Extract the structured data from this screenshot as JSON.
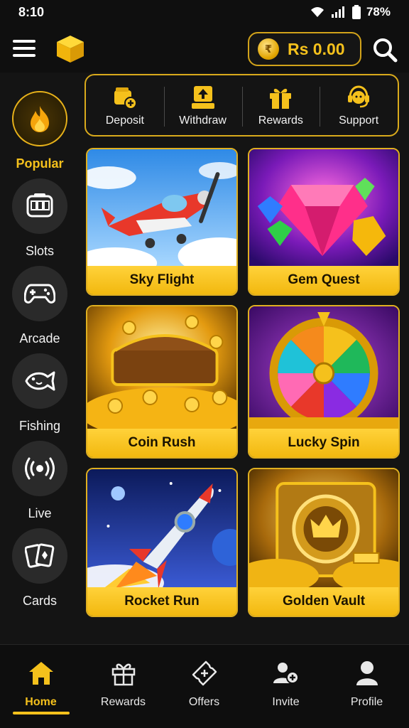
{
  "status_bar": {
    "time": "8:10",
    "battery": "78%"
  },
  "header": {
    "balance": "Rs 0.00",
    "currency_symbol": "₹"
  },
  "sidebar": {
    "items": [
      {
        "label": "Popular",
        "icon": "flame-icon",
        "active": true
      },
      {
        "label": "Slots",
        "icon": "slot-machine-icon",
        "active": false
      },
      {
        "label": "Arcade",
        "icon": "gamepad-icon",
        "active": false
      },
      {
        "label": "Fishing",
        "icon": "fish-icon",
        "active": false
      },
      {
        "label": "Live",
        "icon": "broadcast-icon",
        "active": false
      },
      {
        "label": "Cards",
        "icon": "playing-cards-icon",
        "active": false
      }
    ]
  },
  "quick_actions": [
    {
      "label": "Deposit",
      "icon": "wallet-plus-icon"
    },
    {
      "label": "Withdraw",
      "icon": "withdraw-upload-icon"
    },
    {
      "label": "Rewards",
      "icon": "gift-icon"
    },
    {
      "label": "Support",
      "icon": "headset-icon"
    }
  ],
  "games": [
    {
      "title": "Sky Flight",
      "art": "airplane"
    },
    {
      "title": "Gem Quest",
      "art": "gems"
    },
    {
      "title": "Coin Rush",
      "art": "treasure-chest"
    },
    {
      "title": "Lucky Spin",
      "art": "prize-wheel"
    },
    {
      "title": "Rocket Run",
      "art": "rocket"
    },
    {
      "title": "Golden Vault",
      "art": "vault"
    }
  ],
  "bottom_nav": [
    {
      "label": "Home",
      "icon": "home-icon",
      "active": true
    },
    {
      "label": "Rewards",
      "icon": "gift-icon",
      "active": false
    },
    {
      "label": "Offers",
      "icon": "ticket-plus-icon",
      "active": false
    },
    {
      "label": "Invite",
      "icon": "add-user-icon",
      "active": false
    },
    {
      "label": "Profile",
      "icon": "person-icon",
      "active": false
    }
  ],
  "colors": {
    "accent": "#f5c11c",
    "background": "#141414",
    "card_border": "#e0b020"
  }
}
